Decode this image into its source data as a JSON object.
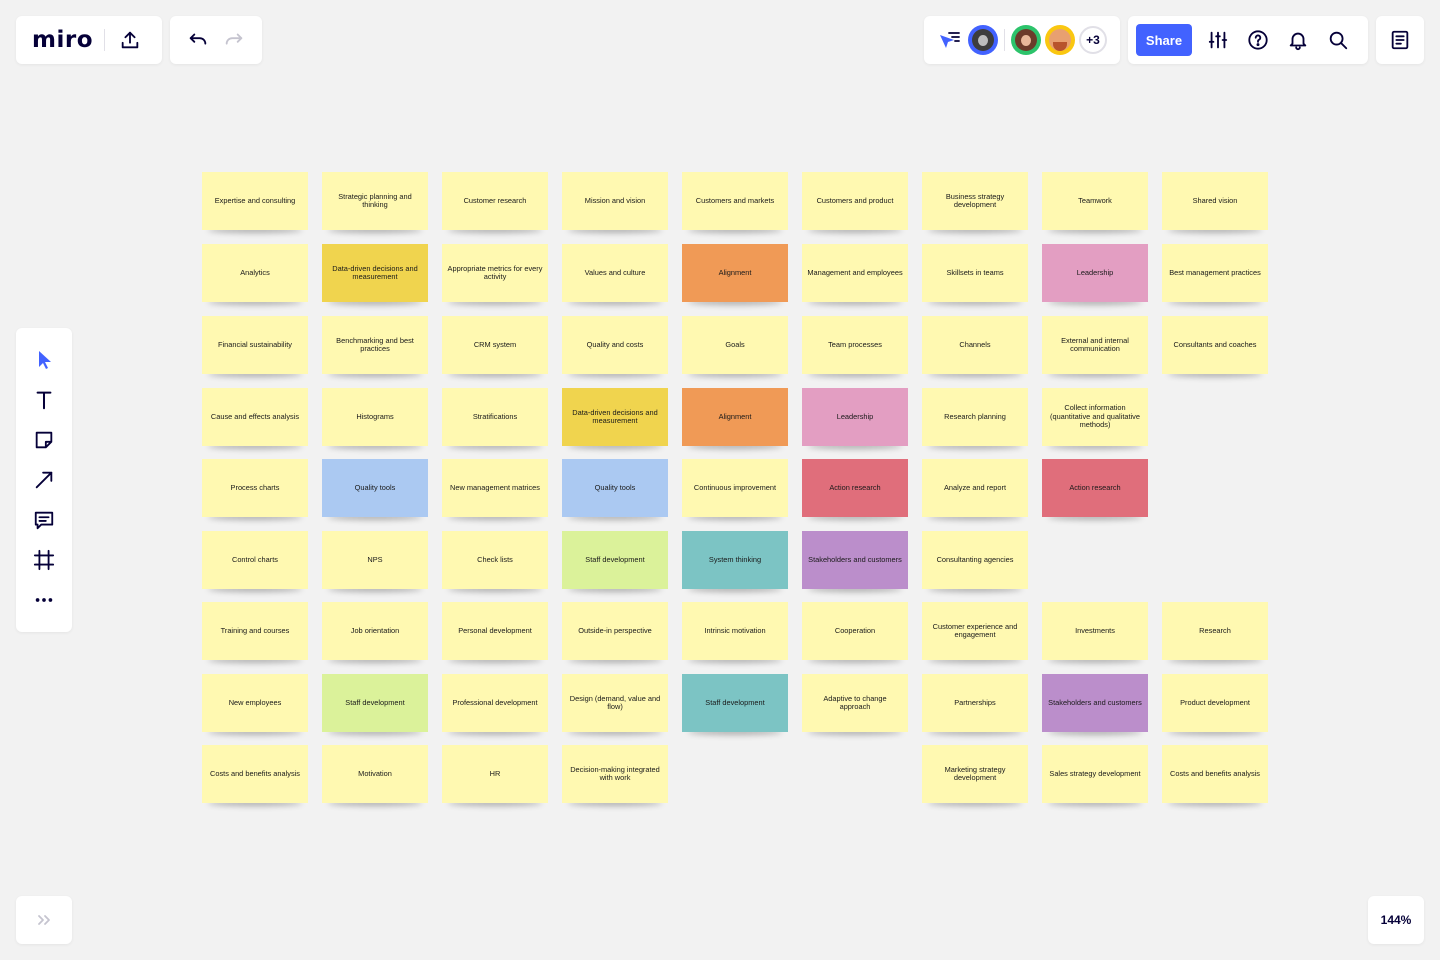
{
  "app": {
    "logo": "miro"
  },
  "header": {
    "share_label": "Share",
    "more_users": "+3"
  },
  "zoom": "144%",
  "colors": {
    "accent": "#4262ff",
    "sticky_yellow": "#fff9b1",
    "sticky_gold": "#f0d44e",
    "sticky_orange": "#f09a56",
    "sticky_pink": "#e39ec2",
    "sticky_red": "#e06e7b",
    "sticky_blue": "#abc9f2",
    "sticky_green": "#dbf29a",
    "sticky_teal": "#7cc4c4",
    "sticky_purple": "#bb8ecb"
  },
  "icons": {
    "header": [
      "upload-icon",
      "undo-icon",
      "redo-icon",
      "collaborator-cursor-icon",
      "settings-sliders-icon",
      "help-icon",
      "bell-icon",
      "search-icon",
      "notes-icon"
    ],
    "toolbar": [
      "select-cursor-icon",
      "text-icon",
      "sticky-note-icon",
      "line-arrow-icon",
      "comment-icon",
      "frame-icon",
      "more-icon"
    ],
    "bottom": [
      "expand-chevrons-icon"
    ]
  },
  "board": {
    "columns": [
      [
        {
          "text": "Expertise and consulting",
          "color": "#fff9b1"
        },
        {
          "text": "Analytics",
          "color": "#fff9b1"
        },
        {
          "text": "Financial sustainability",
          "color": "#fff9b1"
        },
        {
          "text": "Cause and effects analysis",
          "color": "#fff9b1"
        },
        {
          "text": "Process charts",
          "color": "#fff9b1"
        },
        {
          "text": "Control charts",
          "color": "#fff9b1"
        },
        {
          "text": "Training and courses",
          "color": "#fff9b1"
        },
        {
          "text": "New employees",
          "color": "#fff9b1"
        },
        {
          "text": "Costs and benefits analysis",
          "color": "#fff9b1"
        }
      ],
      [
        {
          "text": "Strategic planning and thinking",
          "color": "#fff9b1"
        },
        {
          "text": "Data-driven decisions and measurement",
          "color": "#f0d44e"
        },
        {
          "text": "Benchmarking and best practices",
          "color": "#fff9b1"
        },
        {
          "text": "Histograms",
          "color": "#fff9b1"
        },
        {
          "text": "Quality tools",
          "color": "#abc9f2"
        },
        {
          "text": "NPS",
          "color": "#fff9b1"
        },
        {
          "text": "Job orientation",
          "color": "#fff9b1"
        },
        {
          "text": "Staff development",
          "color": "#dbf29a"
        },
        {
          "text": "Motivation",
          "color": "#fff9b1"
        }
      ],
      [
        {
          "text": "Customer research",
          "color": "#fff9b1"
        },
        {
          "text": "Appropriate metrics for every activity",
          "color": "#fff9b1"
        },
        {
          "text": "CRM system",
          "color": "#fff9b1"
        },
        {
          "text": "Stratifications",
          "color": "#fff9b1"
        },
        {
          "text": "New management matrices",
          "color": "#fff9b1"
        },
        {
          "text": "Check lists",
          "color": "#fff9b1"
        },
        {
          "text": "Personal development",
          "color": "#fff9b1"
        },
        {
          "text": "Professional development",
          "color": "#fff9b1"
        },
        {
          "text": "HR",
          "color": "#fff9b1"
        }
      ],
      [
        {
          "text": "Mission and vision",
          "color": "#fff9b1"
        },
        {
          "text": "Values and culture",
          "color": "#fff9b1"
        },
        {
          "text": "Quality and costs",
          "color": "#fff9b1"
        },
        {
          "text": "Data-driven decisions and measurement",
          "color": "#f0d44e"
        },
        {
          "text": "Quality tools",
          "color": "#abc9f2"
        },
        {
          "text": "Staff development",
          "color": "#dbf29a"
        },
        {
          "text": "Outside-in perspective",
          "color": "#fff9b1"
        },
        {
          "text": "Design (demand, value and flow)",
          "color": "#fff9b1"
        },
        {
          "text": "Decision-making integrated with work",
          "color": "#fff9b1"
        }
      ],
      [
        {
          "text": "Customers and markets",
          "color": "#fff9b1"
        },
        {
          "text": "Alignment",
          "color": "#f09a56"
        },
        {
          "text": "Goals",
          "color": "#fff9b1"
        },
        {
          "text": "Alignment",
          "color": "#f09a56"
        },
        {
          "text": "Continuous improvement",
          "color": "#fff9b1"
        },
        {
          "text": "System thinking",
          "color": "#7cc4c4"
        },
        {
          "text": "Intrinsic motivation",
          "color": "#fff9b1"
        },
        {
          "text": "Staff development",
          "color": "#7cc4c4"
        },
        null
      ],
      [
        {
          "text": "Customers and product",
          "color": "#fff9b1"
        },
        {
          "text": "Management and employees",
          "color": "#fff9b1"
        },
        {
          "text": "Team processes",
          "color": "#fff9b1"
        },
        {
          "text": "Leadership",
          "color": "#e39ec2"
        },
        {
          "text": "Action research",
          "color": "#e06e7b"
        },
        {
          "text": "Stakeholders and customers",
          "color": "#bb8ecb"
        },
        {
          "text": "Cooperation",
          "color": "#fff9b1"
        },
        {
          "text": "Adaptive to change approach",
          "color": "#fff9b1"
        },
        null
      ],
      [
        {
          "text": "Business strategy development",
          "color": "#fff9b1"
        },
        {
          "text": "Skillsets in teams",
          "color": "#fff9b1"
        },
        {
          "text": "Channels",
          "color": "#fff9b1"
        },
        {
          "text": "Research planning",
          "color": "#fff9b1"
        },
        {
          "text": "Analyze and report",
          "color": "#fff9b1"
        },
        {
          "text": "Consultanting agencies",
          "color": "#fff9b1"
        },
        {
          "text": "Customer experience and engagement",
          "color": "#fff9b1"
        },
        {
          "text": "Partnerships",
          "color": "#fff9b1"
        },
        {
          "text": "Marketing strategy development",
          "color": "#fff9b1"
        }
      ],
      [
        {
          "text": "Teamwork",
          "color": "#fff9b1"
        },
        {
          "text": "Leadership",
          "color": "#e39ec2"
        },
        {
          "text": "External and internal communication",
          "color": "#fff9b1"
        },
        {
          "text": "Collect information (quantitative and qualitative methods)",
          "color": "#fff9b1"
        },
        {
          "text": "Action research",
          "color": "#e06e7b"
        },
        null,
        {
          "text": "Investments",
          "color": "#fff9b1"
        },
        {
          "text": "Stakeholders and customers",
          "color": "#bb8ecb"
        },
        {
          "text": "Sales strategy development",
          "color": "#fff9b1"
        }
      ],
      [
        {
          "text": "Shared vision",
          "color": "#fff9b1"
        },
        {
          "text": "Best management practices",
          "color": "#fff9b1"
        },
        {
          "text": "Consultants and coaches",
          "color": "#fff9b1"
        },
        null,
        null,
        null,
        {
          "text": "Research",
          "color": "#fff9b1"
        },
        {
          "text": "Product development",
          "color": "#fff9b1"
        },
        {
          "text": "Costs and benefits analysis",
          "color": "#fff9b1"
        }
      ]
    ]
  }
}
